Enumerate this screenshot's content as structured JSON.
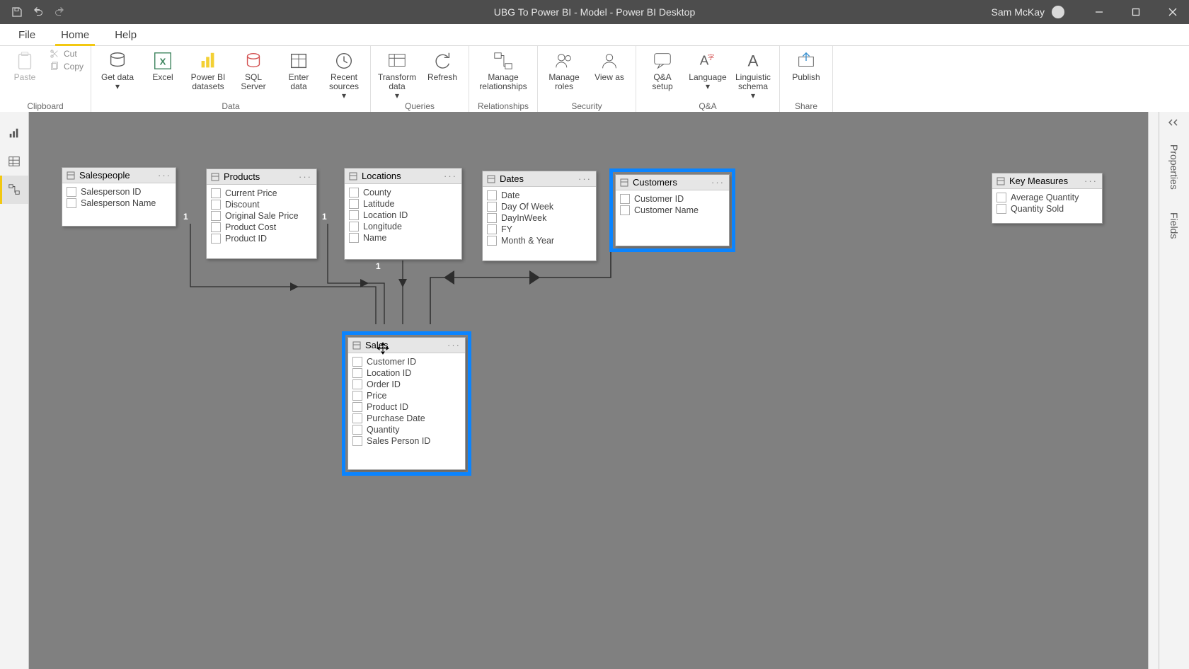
{
  "app_title": "UBG To Power BI - Model - Power BI Desktop",
  "user_name": "Sam McKay",
  "tabs": {
    "file": "File",
    "home": "Home",
    "help": "Help"
  },
  "ribbon": {
    "clipboard": {
      "paste": "Paste",
      "cut": "Cut",
      "copy": "Copy",
      "label": "Clipboard"
    },
    "data": {
      "get_data": "Get data",
      "excel": "Excel",
      "pbi_datasets": "Power BI datasets",
      "sql_server": "SQL Server",
      "enter_data": "Enter data",
      "recent_sources": "Recent sources",
      "label": "Data"
    },
    "queries": {
      "transform_data": "Transform data",
      "refresh": "Refresh",
      "label": "Queries"
    },
    "relationships": {
      "manage": "Manage relationships",
      "label": "Relationships"
    },
    "security": {
      "manage_roles": "Manage roles",
      "view_as": "View as",
      "label": "Security"
    },
    "qa": {
      "qa_setup": "Q&A setup",
      "language": "Language",
      "ling_schema": "Linguistic schema",
      "label": "Q&A"
    },
    "share": {
      "publish": "Publish",
      "label": "Share"
    }
  },
  "panes": {
    "fields": "Fields",
    "properties": "Properties"
  },
  "tables": {
    "salespeople": {
      "name": "Salespeople",
      "fields": [
        "Salesperson ID",
        "Salesperson Name"
      ]
    },
    "products": {
      "name": "Products",
      "fields": [
        "Current Price",
        "Discount",
        "Original Sale Price",
        "Product Cost",
        "Product ID"
      ]
    },
    "locations": {
      "name": "Locations",
      "fields": [
        "County",
        "Latitude",
        "Location ID",
        "Longitude",
        "Name"
      ]
    },
    "dates": {
      "name": "Dates",
      "fields": [
        "Date",
        "Day Of Week",
        "DayInWeek",
        "FY",
        "Month & Year"
      ]
    },
    "customers": {
      "name": "Customers",
      "fields": [
        "Customer ID",
        "Customer Name"
      ]
    },
    "sales": {
      "name": "Sales",
      "fields": [
        "Customer ID",
        "Location ID",
        "Order ID",
        "Price",
        "Product ID",
        "Purchase Date",
        "Quantity",
        "Sales Person ID"
      ]
    },
    "measures": {
      "name": "Key Measures",
      "fields": [
        "Average Quantity",
        "Quantity Sold"
      ]
    }
  },
  "cardinality_one": "1"
}
